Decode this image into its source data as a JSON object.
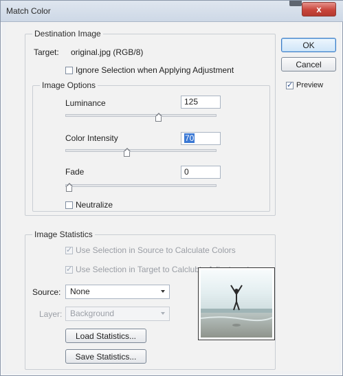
{
  "window": {
    "title": "Match Color",
    "close_label": "x"
  },
  "destination": {
    "legend": "Destination Image",
    "target_label": "Target:",
    "target_value": "original.jpg (RGB/8)",
    "ignore_selection_label": "Ignore Selection when Applying Adjustment",
    "ignore_selection_checked": false
  },
  "image_options": {
    "legend": "Image Options",
    "luminance_label": "Luminance",
    "luminance_value": "125",
    "luminance_slider": 0.62,
    "color_intensity_label": "Color Intensity",
    "color_intensity_value": "70",
    "color_intensity_slider": 0.4,
    "fade_label": "Fade",
    "fade_value": "0",
    "fade_slider": 0.0,
    "neutralize_label": "Neutralize",
    "neutralize_checked": false
  },
  "image_statistics": {
    "legend": "Image Statistics",
    "use_source_label": "Use Selection in Source to Calculate Colors",
    "use_target_label": "Use Selection in Target to Calclubte Adjustment",
    "source_label": "Source:",
    "source_value": "None",
    "layer_label": "Layer:",
    "layer_value": "Background",
    "load_label": "Load Statistics...",
    "save_label": "Save Statistics..."
  },
  "buttons": {
    "ok": "OK",
    "cancel": "Cancel",
    "preview_label": "Preview",
    "preview_checked": true
  },
  "colors": {
    "accent": "#3a78d4",
    "close": "#c8453b"
  }
}
